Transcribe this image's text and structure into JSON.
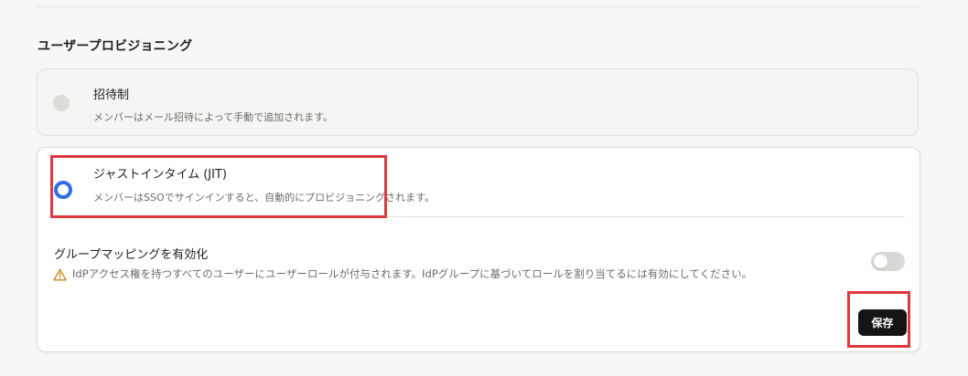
{
  "section": {
    "title": "ユーザープロビジョニング"
  },
  "options": {
    "invite": {
      "title": "招待制",
      "description": "メンバーはメール招待によって手動で追加されます。",
      "selected": false
    },
    "jit": {
      "title": "ジャストインタイム (JIT)",
      "description": "メンバーはSSOでサインインすると、自動的にプロビジョニングされます。",
      "selected": true
    }
  },
  "group_mapping": {
    "title": "グループマッピングを有効化",
    "warning": "IdPアクセス権を持つすべてのユーザーにユーザーロールが付与されます。IdPグループに基づいてロールを割り当てるには有効にしてください。",
    "warning_icon": "warning-triangle-icon",
    "enabled": false
  },
  "actions": {
    "save_label": "保存"
  },
  "colors": {
    "accent_radio": "#2f6fe4",
    "save_button_bg": "#151515",
    "highlight": "#e0383e",
    "warning_icon": "#c98a1b"
  }
}
